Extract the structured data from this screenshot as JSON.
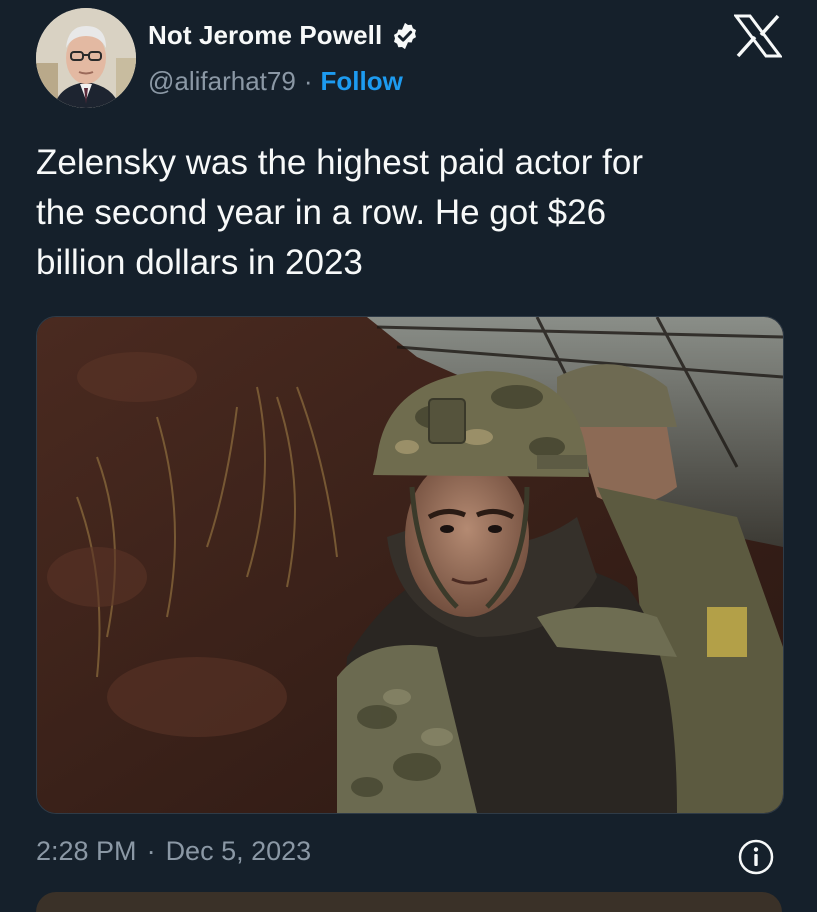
{
  "author": {
    "display_name": "Not Jerome Powell",
    "handle": "@alifarhat79",
    "separator": "·",
    "follow_label": "Follow",
    "verified": true
  },
  "icons": {
    "verified": "verified-badge-icon",
    "x_logo": "x-logo-icon",
    "info": "info-icon"
  },
  "tweet": {
    "text": "Zelensky was the highest paid actor for\nthe second year in a row. He got $26\nbillion dollars in 2023"
  },
  "timestamp": {
    "time": "2:28 PM",
    "separator": "·",
    "date": "Dec 5, 2023"
  },
  "colors": {
    "background": "#15202b",
    "accent": "#1d9bf0",
    "secondary_text": "#8b98a5",
    "primary_text": "#f7f9f9"
  }
}
